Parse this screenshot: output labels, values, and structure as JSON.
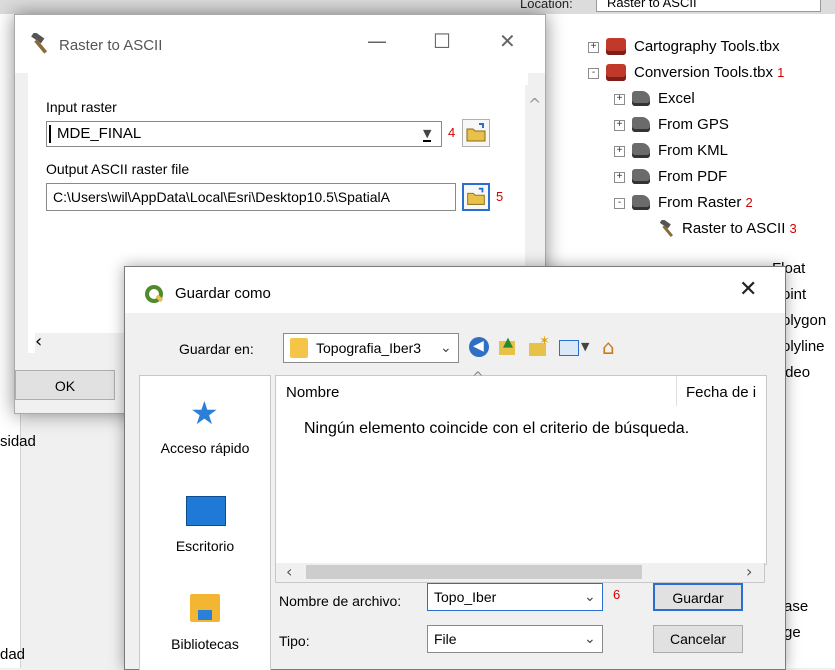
{
  "background": {
    "location_label": "Location:",
    "location_value": "Raster to ASCII",
    "left_texts": [
      "sidad",
      "dad"
    ]
  },
  "catalog_tree": {
    "items": [
      {
        "label": "Cartography Tools.tbx",
        "icon": "toolbox-icon",
        "expander": "+",
        "annotation": ""
      },
      {
        "label": "Conversion Tools.tbx",
        "icon": "toolbox-icon",
        "expander": "-",
        "annotation": "1"
      },
      {
        "label": "Excel",
        "icon": "toolset-icon",
        "expander": "+",
        "annotation": ""
      },
      {
        "label": "From GPS",
        "icon": "toolset-icon",
        "expander": "+",
        "annotation": ""
      },
      {
        "label": "From KML",
        "icon": "toolset-icon",
        "expander": "+",
        "annotation": ""
      },
      {
        "label": "From PDF",
        "icon": "toolset-icon",
        "expander": "+",
        "annotation": ""
      },
      {
        "label": "From Raster",
        "icon": "toolset-icon",
        "expander": "-",
        "annotation": "2"
      },
      {
        "label": "Raster to ASCII",
        "icon": "hammer-icon",
        "expander": "",
        "annotation": "3"
      }
    ],
    "partial_items": [
      "Float",
      "Point",
      "Polygon",
      "Polyline",
      "Video",
      "ase",
      "ge"
    ]
  },
  "raster_to_ascii": {
    "title": "Raster to ASCII",
    "input_label": "Input raster",
    "input_value": "MDE_FINAL",
    "input_annotation": "4",
    "output_label": "Output ASCII raster file",
    "output_value": "C:\\Users\\wil\\AppData\\Local\\Esri\\Desktop10.5\\SpatialA",
    "output_annotation": "5",
    "ok_label": "OK"
  },
  "guardar_como": {
    "title": "Guardar como",
    "save_in_label": "Guardar en:",
    "save_in_value": "Topografia_Iber3",
    "places": [
      {
        "label": "Acceso rápido",
        "icon": "star-icon"
      },
      {
        "label": "Escritorio",
        "icon": "desktop-icon"
      },
      {
        "label": "Bibliotecas",
        "icon": "library-icon"
      }
    ],
    "columns": [
      "Nombre",
      "Fecha de i"
    ],
    "empty_message": "Ningún elemento coincide con el criterio de búsqueda.",
    "filename_label": "Nombre de archivo:",
    "filename_value": "Topo_Iber",
    "filename_annotation": "6",
    "type_label": "Tipo:",
    "type_value": "File",
    "save_button": "Guardar",
    "cancel_button": "Cancelar"
  }
}
